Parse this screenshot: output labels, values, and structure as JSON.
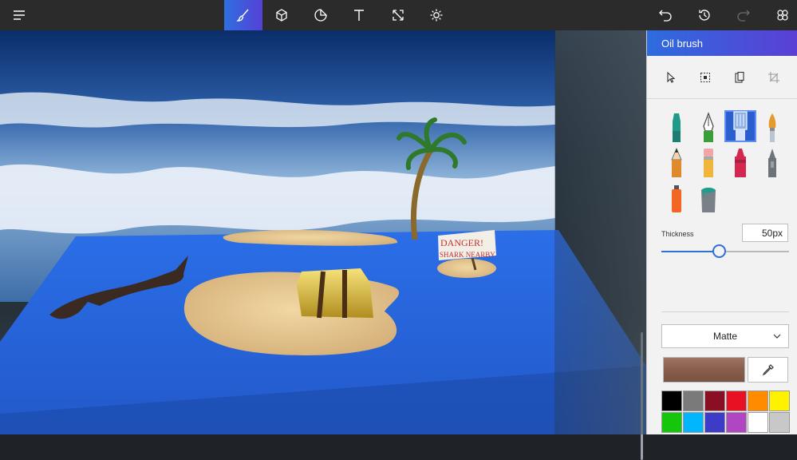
{
  "app": {
    "top_toolbar": {
      "tools": [
        {
          "name": "menu",
          "icon": "hamburger-menu-icon"
        },
        {
          "name": "brushes",
          "icon": "brush-icon",
          "active": true
        },
        {
          "name": "3d-shapes",
          "icon": "cube-icon"
        },
        {
          "name": "stickers",
          "icon": "sticker-icon"
        },
        {
          "name": "text",
          "icon": "text-icon"
        },
        {
          "name": "canvas",
          "icon": "resize-canvas-icon"
        },
        {
          "name": "effects",
          "icon": "sun-icon"
        },
        {
          "name": "undo",
          "icon": "undo-icon"
        },
        {
          "name": "history",
          "icon": "history-icon"
        },
        {
          "name": "redo",
          "icon": "redo-icon",
          "disabled": true
        },
        {
          "name": "remix-3d",
          "icon": "remix-3d-icon"
        }
      ]
    },
    "canvas": {
      "scene_sign_line1": "DANGER!",
      "scene_sign_line2": "SHARK NEARBY"
    },
    "panel": {
      "title": "Oil brush",
      "selection_tools": [
        "select-arrow-icon",
        "magic-select-icon",
        "paste-icon",
        "crop-icon"
      ],
      "brushes": [
        {
          "name": "marker",
          "icon": "marker-icon",
          "color": "#1f9a8a"
        },
        {
          "name": "calligraphy-pen",
          "icon": "calligraphy-pen-icon",
          "color": "#3a9d3a"
        },
        {
          "name": "oil-brush",
          "icon": "oil-brush-icon",
          "color": "#8fb2e8",
          "selected": true
        },
        {
          "name": "watercolor",
          "icon": "watercolor-brush-icon",
          "color": "#e39a2e"
        },
        {
          "name": "pencil",
          "icon": "pencil-icon",
          "color": "#e08a2e"
        },
        {
          "name": "eraser",
          "icon": "eraser-icon",
          "color": "#f0a6a6"
        },
        {
          "name": "crayon",
          "icon": "crayon-icon",
          "color": "#d3294f"
        },
        {
          "name": "pixel-pen",
          "icon": "pixel-pen-icon",
          "color": "#6d737b"
        },
        {
          "name": "spray-can",
          "icon": "spray-can-icon",
          "color": "#f26522"
        },
        {
          "name": "fill",
          "icon": "fill-bucket-icon",
          "color": "#1e9e8e"
        }
      ],
      "thickness_label": "Thickness",
      "thickness_value": "50px",
      "thickness_level": 0.45,
      "finish_value": "Matte",
      "current_color": "#8a5f4d",
      "accent_color": "#2f6fd8",
      "palette": [
        "#000000",
        "#7a7a7a",
        "#8a0f24",
        "#e81123",
        "#ff8c00",
        "#fff100",
        "#16c60c",
        "#00b7ff",
        "#3c3cc8",
        "#b146c2",
        "#ffffff",
        "#c8c8c8"
      ]
    }
  }
}
